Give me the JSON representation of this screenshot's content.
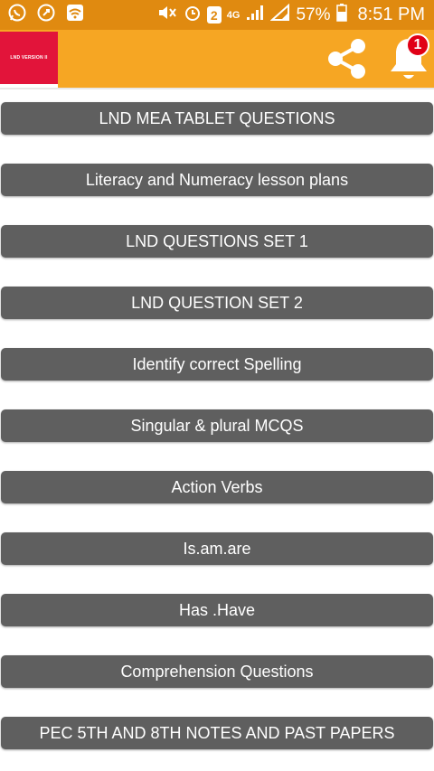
{
  "status_bar": {
    "battery_percent": "57%",
    "time": "8:51 PM",
    "network": "4G",
    "sim_badge": "2"
  },
  "app_bar": {
    "logo_text": "LND VERSION II",
    "notification_count": "1"
  },
  "menu": {
    "items": [
      "LND MEA TABLET QUESTIONS",
      "Literacy and Numeracy lesson plans",
      "LND QUESTIONS SET 1",
      "LND QUESTION SET 2",
      "Identify correct Spelling",
      "Singular & plural MCQS",
      "Action Verbs",
      "Is.am.are",
      "Has .Have",
      "Comprehension Questions",
      "PEC 5TH AND 8TH NOTES AND PAST PAPERS"
    ]
  },
  "colors": {
    "app_bar": "#f6a623",
    "status_bar": "#e08a10",
    "button": "#5f5f5f",
    "logo": "#e2143a",
    "badge": "#e00016"
  }
}
